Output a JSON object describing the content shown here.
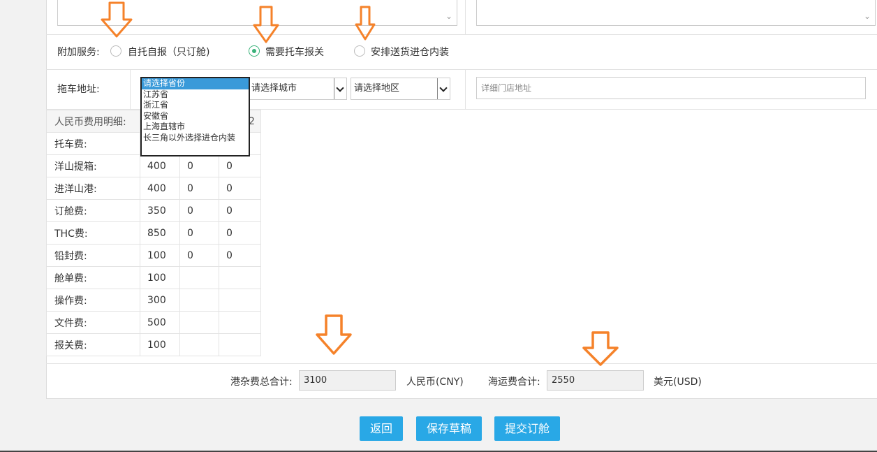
{
  "additional_service": {
    "label": "附加服务:",
    "options": [
      {
        "label": "自托自报（只订舱)",
        "checked": false
      },
      {
        "label": "需要托车报关",
        "checked": true
      },
      {
        "label": "安排送货进仓内装",
        "checked": false
      }
    ]
  },
  "truck_address": {
    "label": "拖车地址:",
    "province_dropdown_options": [
      "请选择省份",
      "江苏省",
      "浙江省",
      "安徽省",
      "上海直辖市",
      "长三角以外选择进仓内装"
    ],
    "city_placeholder": "请选择城市",
    "district_placeholder": "请选择地区",
    "detail_placeholder": "详细门店地址"
  },
  "fee_table": {
    "header": "人民币费用明细:",
    "header_tail": "2",
    "rows": [
      {
        "name": "托车费:",
        "v1": "",
        "v2": "",
        "v3": ""
      },
      {
        "name": "洋山提箱:",
        "v1": "400",
        "v2": "0",
        "v3": "0"
      },
      {
        "name": "进洋山港:",
        "v1": "400",
        "v2": "0",
        "v3": "0"
      },
      {
        "name": "订舱费:",
        "v1": "350",
        "v2": "0",
        "v3": "0"
      },
      {
        "name": "THC费:",
        "v1": "850",
        "v2": "0",
        "v3": "0"
      },
      {
        "name": "铅封费:",
        "v1": "100",
        "v2": "0",
        "v3": "0"
      },
      {
        "name": "舱单费:",
        "v1": "100",
        "v2": "",
        "v3": ""
      },
      {
        "name": "操作费:",
        "v1": "300",
        "v2": "",
        "v3": ""
      },
      {
        "name": "文件费:",
        "v1": "500",
        "v2": "",
        "v3": ""
      },
      {
        "name": "报关费:",
        "v1": "100",
        "v2": "",
        "v3": ""
      }
    ]
  },
  "totals": {
    "port_label": "港杂费总合计:",
    "port_value": "3100",
    "port_currency": "人民币(CNY)",
    "freight_label": "海运费合计:",
    "freight_value": "2550",
    "freight_currency": "美元(USD)"
  },
  "buttons": {
    "back": "返回",
    "save_draft": "保存草稿",
    "submit": "提交订舱"
  },
  "colors": {
    "primary_button": "#29a8e6",
    "radio_checked": "#3ab27a",
    "annotation_arrow": "#f5822a",
    "dropdown_selected": "#3a9ad9"
  }
}
